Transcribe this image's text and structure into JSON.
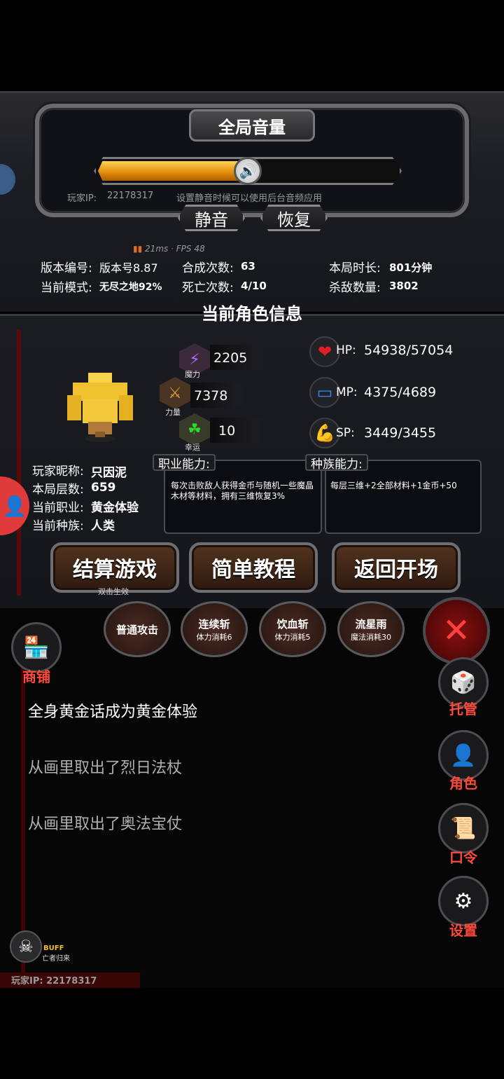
{
  "settings": {
    "title": "全局音量",
    "volume_percent": 50,
    "player_ip_label": "玩家IP:",
    "player_ip": "22178317",
    "mute_hint": "设置静音时候可以使用后台音频应用",
    "mute_btn": "静音",
    "restore_btn": "恢复",
    "net_ms": "21ms",
    "fps": "FPS 48"
  },
  "stats": {
    "version_label": "版本编号:",
    "version_value": "版本号8.87",
    "mode_label": "当前模式:",
    "mode_value": "无尽之地92%",
    "craft_label": "合成次数:",
    "craft_value": "63",
    "death_label": "死亡次数:",
    "death_value": "4/10",
    "duration_label": "本局时长:",
    "duration_value": "801分钟",
    "kills_label": "杀敌数量:",
    "kills_value": "3802"
  },
  "character": {
    "title": "当前角色信息",
    "magic_value": "2205",
    "magic_caption": "魔力",
    "strength_value": "7378",
    "strength_caption": "力量",
    "luck_value": "10",
    "luck_caption": "幸运",
    "hp_label": "HP:",
    "hp_value": "54938/57054",
    "mp_label": "MP:",
    "mp_value": "4375/4689",
    "sp_label": "SP:",
    "sp_value": "3449/3455",
    "nickname_label": "玩家昵称:",
    "nickname_value": "只因泥",
    "floor_label": "本局层数:",
    "floor_value": "659",
    "job_label": "当前职业:",
    "job_value": "黄金体验",
    "race_label": "当前种族:",
    "race_value": "人类",
    "job_ability_tag": "职业能力:",
    "job_ability_desc": "每次击败敌人获得金币与随机一些魔晶木材等材料，拥有三维恢复3%",
    "race_ability_tag": "种族能力:",
    "race_ability_desc": "每层三维+2全部材料+1金币+50"
  },
  "actions": {
    "settle": "结算游戏",
    "settle_hint": "双击生效",
    "tutorial": "简单教程",
    "back": "返回开场"
  },
  "skills": [
    {
      "name": "普通攻击",
      "cost": ""
    },
    {
      "name": "连续斩",
      "cost": "体力消耗6"
    },
    {
      "name": "饮血斩",
      "cost": "体力消耗5"
    },
    {
      "name": "流星雨",
      "cost": "魔法消耗30"
    }
  ],
  "side": {
    "shop": "商铺",
    "auto": "托管",
    "role": "角色",
    "code": "口令",
    "settings": "设置"
  },
  "log": [
    "全身黄金话成为黄金体验",
    "从画里取出了烈日法杖",
    "从画里取出了奥法宝仗"
  ],
  "buff": {
    "label": "BUFF",
    "name": "亡者归来"
  },
  "footer_ip": "玩家IP:  22178317"
}
